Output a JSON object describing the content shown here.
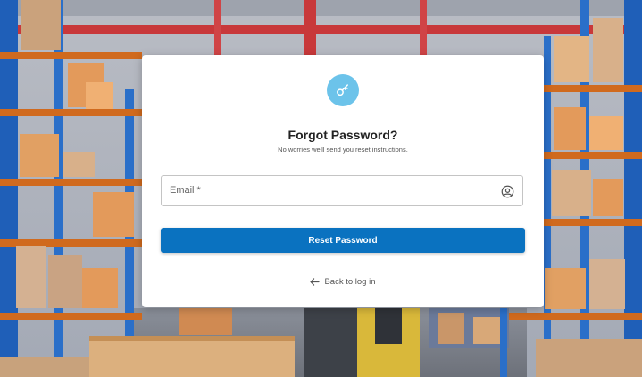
{
  "background": {
    "scene": "warehouse-shelves-image"
  },
  "card": {
    "badge_icon": "key-icon",
    "title": "Forgot Password?",
    "subtitle": "No worries we'll send you reset instructions.",
    "email": {
      "label": "Email *",
      "value": "",
      "icon": "account-circle-icon"
    },
    "reset_button_label": "Reset Password",
    "back_link": {
      "icon": "arrow-left-icon",
      "label": "Back to log in"
    }
  },
  "colors": {
    "accent": "#0a72c0",
    "badge": "#6cc3ea",
    "card_bg": "#ffffff",
    "field_border": "#c4c4c4"
  }
}
